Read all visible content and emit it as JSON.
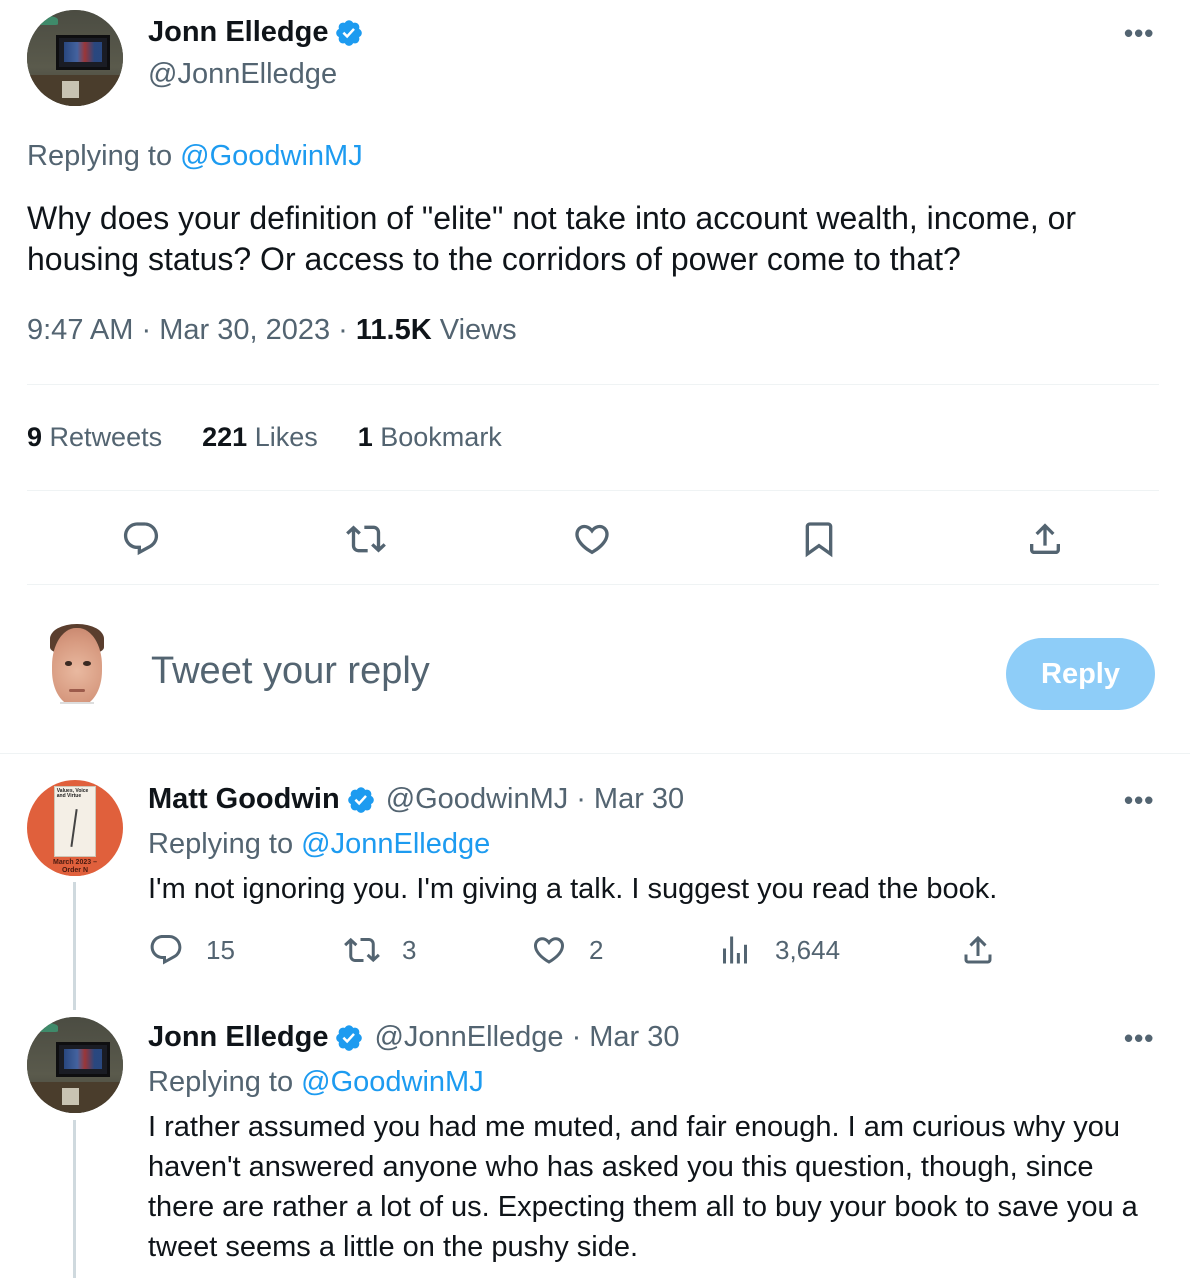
{
  "main_tweet": {
    "author": {
      "name": "Jonn Elledge",
      "handle": "@JonnElledge"
    },
    "replying_to_label": "Replying to",
    "replying_to_handle": "@GoodwinMJ",
    "text": "Why does your definition of \"elite\" not take into account wealth, income, or housing status? Or access to the corridors of power come to that?",
    "time": "9:47 AM",
    "date": "Mar 30, 2023",
    "views_count": "11.5K",
    "views_label": "Views",
    "stats": {
      "retweets_count": "9",
      "retweets_label": "Retweets",
      "likes_count": "221",
      "likes_label": "Likes",
      "bookmarks_count": "1",
      "bookmarks_label": "Bookmark"
    },
    "more_label": "•••"
  },
  "compose": {
    "placeholder": "Tweet your reply",
    "reply_button": "Reply"
  },
  "replies": [
    {
      "name": "Matt Goodwin",
      "handle": "@GoodwinMJ",
      "date": "Mar 30",
      "replying_to_label": "Replying to",
      "replying_to_handle": "@JonnElledge",
      "text": "I'm not ignoring you. I'm giving a talk. I suggest you read the book.",
      "avatar_book_title": "Values, Voice and Virtue",
      "avatar_band_text": "March 2023 – Order N",
      "counts": {
        "replies": "15",
        "retweets": "3",
        "likes": "2",
        "views": "3,644"
      }
    },
    {
      "name": "Jonn Elledge",
      "handle": "@JonnElledge",
      "date": "Mar 30",
      "replying_to_label": "Replying to",
      "replying_to_handle": "@GoodwinMJ",
      "text": "I rather assumed you had me muted, and fair enough. I am curious why you haven't answered anyone who has asked you this question, though, since there are rather a lot of us. Expecting them all to buy your book to save you a tweet seems a little on the pushy side."
    }
  ],
  "separator": "·",
  "colors": {
    "link": "#1d9bf0",
    "muted": "#536471",
    "text": "#0f1419",
    "reply_button": "#8ecdf8",
    "verified": "#1d9bf0"
  },
  "icons": [
    "verified-badge-icon",
    "more-icon",
    "reply-icon",
    "retweet-icon",
    "like-icon",
    "bookmark-icon",
    "share-icon",
    "views-icon"
  ]
}
